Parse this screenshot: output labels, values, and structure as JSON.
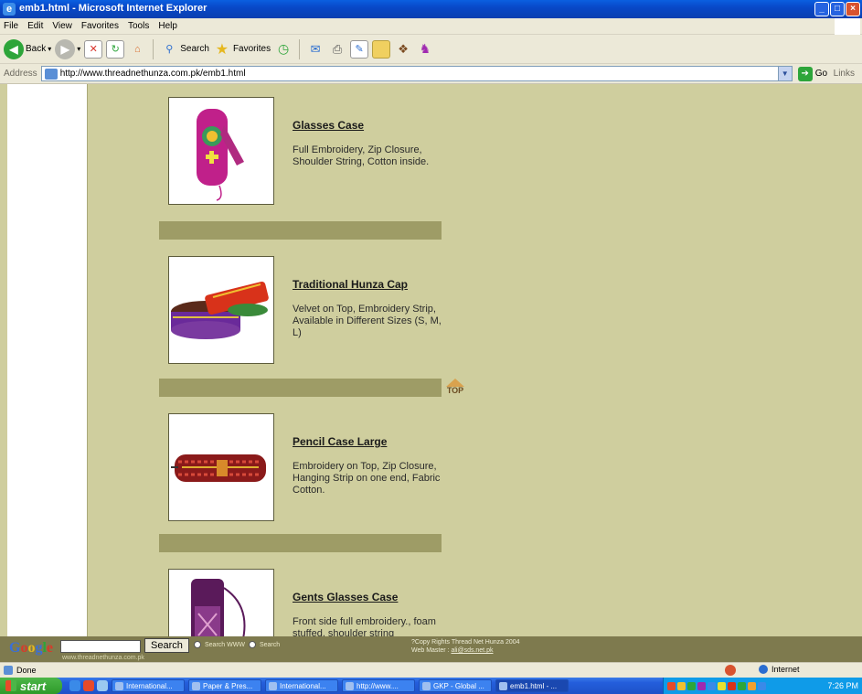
{
  "window": {
    "title": "emb1.html - Microsoft Internet Explorer"
  },
  "menu": {
    "items": [
      "File",
      "Edit",
      "View",
      "Favorites",
      "Tools",
      "Help"
    ]
  },
  "toolbar": {
    "back_label": "Back",
    "search_label": "Search",
    "favorites_label": "Favorites"
  },
  "address": {
    "label": "Address",
    "url": "http://www.threadnethunza.com.pk/emb1.html",
    "go_label": "Go",
    "links_label": "Links"
  },
  "products": [
    {
      "name": "Glasses Case",
      "description": "Full Embroidery, Zip Closure, Shoulder String, Cotton inside."
    },
    {
      "name": "Traditional Hunza Cap",
      "description": "Velvet on Top, Embroidery Strip, Available in Different Sizes (S, M, L)"
    },
    {
      "name": "Pencil Case Large",
      "description": "Embroidery on Top, Zip Closure, Hanging Strip on one end, Fabric Cotton."
    },
    {
      "name": "Gents Glasses Case",
      "description": "Front side full embroidery., foam stuffed, shoulder string"
    }
  ],
  "top_link": {
    "label": "TOP"
  },
  "footer": {
    "google_logo_letters": [
      "G",
      "o",
      "o",
      "g",
      "l",
      "e"
    ],
    "search_button": "Search",
    "radio_web": "Search WWW",
    "radio_site": "Search",
    "site_url": "www.threadnethunza.com.pk",
    "copyright": "?Copy Rights  Thread Net Hunza 2004",
    "webmaster_label": "Web Master :",
    "webmaster_email": "ali@sds.net.pk"
  },
  "status": {
    "text": "Done",
    "zone": "Internet"
  },
  "taskbar": {
    "start_label": "start",
    "tasks": [
      {
        "label": "International...",
        "active": false
      },
      {
        "label": "Paper & Pres...",
        "active": false
      },
      {
        "label": "International...",
        "active": false
      },
      {
        "label": "http://www....",
        "active": false
      },
      {
        "label": "GKP - Global ...",
        "active": false
      },
      {
        "label": "emb1.html - ...",
        "active": true
      }
    ],
    "clock": "7:26 PM"
  },
  "colors": {
    "page_bg": "#CFCE9E",
    "divider": "#9E9C66",
    "footer_bg": "#7E7A4E"
  }
}
